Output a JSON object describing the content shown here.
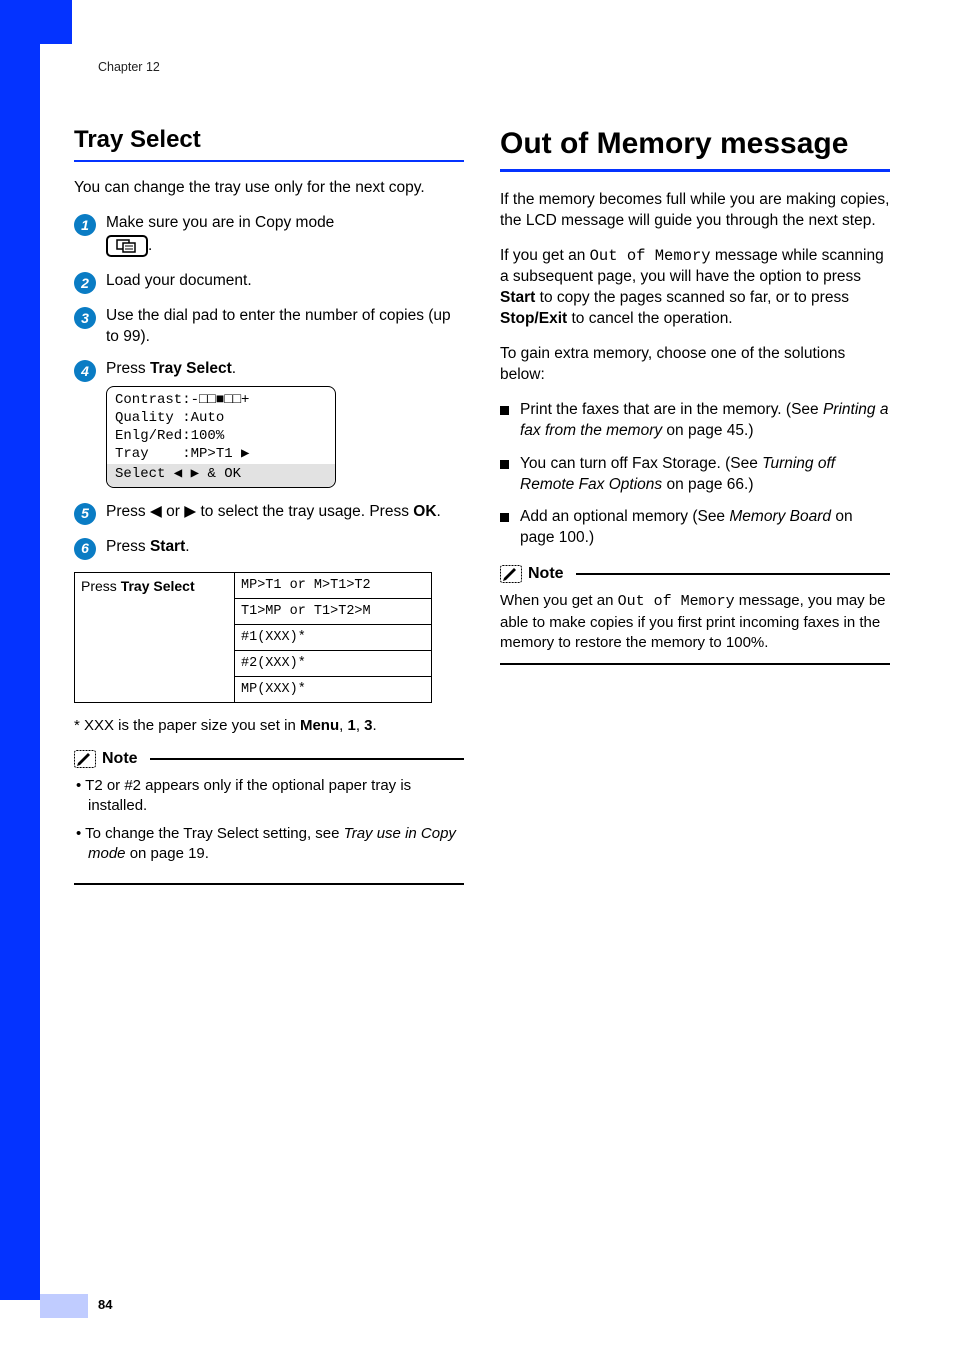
{
  "chapter_label": "Chapter 12",
  "page_number": "84",
  "left": {
    "heading": "Tray Select",
    "intro": "You can change the tray use only for the next copy.",
    "steps": {
      "s1": "Make sure you are in Copy mode ",
      "s1_period": ".",
      "s2": "Load your document.",
      "s3": "Use the dial pad to enter the number of copies (up to 99).",
      "s4_a": "Press ",
      "s4_b": "Tray Select",
      "s4_c": ".",
      "lcd_l1": "Contrast:-□□■□□+",
      "lcd_l2": "Quality :Auto",
      "lcd_l3": "Enlg/Red:100%",
      "lcd_l4": "Tray    :MP>T1 ▶",
      "lcd_l5": "Select ◀ ▶ & OK",
      "s5_a": "Press ◀ or ▶ to select the tray usage. Press ",
      "s5_b": "OK",
      "s5_c": ".",
      "s6_a": "Press ",
      "s6_b": "Start",
      "s6_c": "."
    },
    "table": {
      "header_a": "Press ",
      "header_b": "Tray Select",
      "r1": "MP>T1 or M>T1>T2",
      "r2": "T1>MP or T1>T2>M",
      "r3": "#1(XXX)*",
      "r4": "#2(XXX)*",
      "r5": "MP(XXX)*"
    },
    "footnote_a": "* XXX is the paper size you set in ",
    "footnote_b": "Menu",
    "footnote_c": ", ",
    "footnote_d": "1",
    "footnote_e": ", ",
    "footnote_f": "3",
    "footnote_g": ".",
    "note_label": "Note",
    "note_li1": "T2 or #2 appears only if the optional paper tray is installed.",
    "note_li2_a": "To change the Tray Select setting, see ",
    "note_li2_b": "Tray use in Copy mode",
    "note_li2_c": " on page 19."
  },
  "right": {
    "heading": "Out of Memory message",
    "p1": "If the memory becomes full while you are making copies, the LCD message will guide you through the next step.",
    "p2_a": "If you get an ",
    "p2_b": "Out of Memory",
    "p2_c": " message while scanning a subsequent page, you will have the option to press ",
    "p2_d": "Start",
    "p2_e": " to copy the pages scanned so far, or to press ",
    "p2_f": "Stop/Exit",
    "p2_g": " to cancel the operation.",
    "p3": "To gain extra memory, choose one of the solutions below:",
    "a1_a": "Print the faxes that are in the memory. (See ",
    "a1_b": "Printing a fax from the memory",
    "a1_c": " on page 45.)",
    "a2_a": "You can turn off Fax Storage. (See ",
    "a2_b": "Turning off Remote Fax Options",
    "a2_c": " on page 66.)",
    "a3_a": "Add an optional memory (See ",
    "a3_b": "Memory Board",
    "a3_c": " on page 100.)",
    "note_label": "Note",
    "note_body_a": "When you get an ",
    "note_body_b": "Out of Memory",
    "note_body_c": " message, you may be able to make copies if you first print incoming faxes in the memory to restore the memory to 100%."
  }
}
